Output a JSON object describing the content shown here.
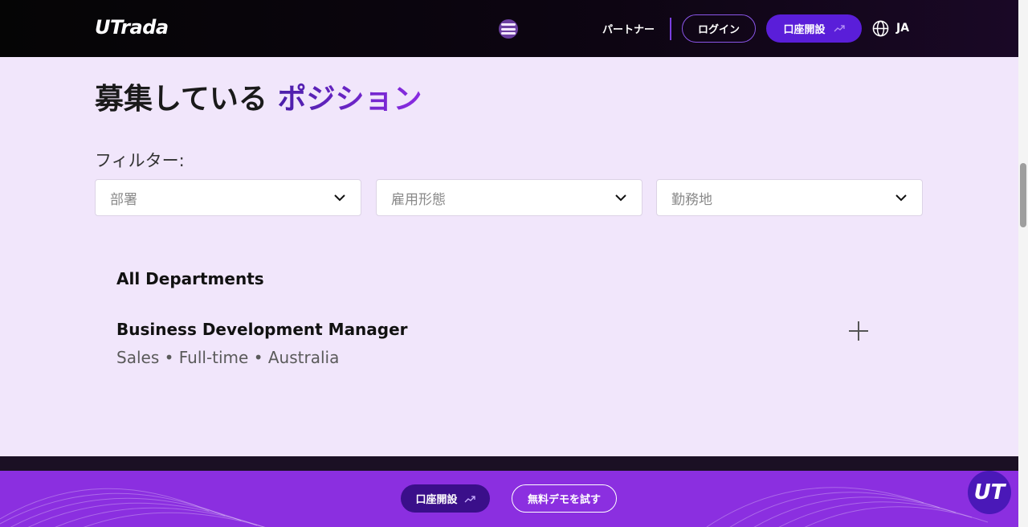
{
  "header": {
    "logo": "UTrada",
    "menu_icon": "menu-icon",
    "partner": "パートナー",
    "login": "ログイン",
    "open_account": "口座開設",
    "open_account_icon": "trending-up-icon",
    "globe_icon": "globe-icon",
    "language": "JA"
  },
  "main": {
    "title_part1": "募集している",
    "title_part2": "ポジション",
    "filter_label": "フィルター:",
    "filters": [
      {
        "placeholder": "部署"
      },
      {
        "placeholder": "雇用形態"
      },
      {
        "placeholder": "勤務地"
      }
    ],
    "department": "All Departments",
    "job": {
      "title": "Business Development Manager",
      "meta": "Sales • Full-time • Australia",
      "expand_icon": "plus-icon"
    }
  },
  "cta": {
    "open_account": "口座開設",
    "demo": "無料デモを試す"
  },
  "badge": "UT",
  "colors": {
    "accent": "#6322c9",
    "header_bg": "#050505",
    "page_bg": "#f1e6fb",
    "cta_bg": "#8b2fe0",
    "button_purple": "#5a1ed9"
  }
}
